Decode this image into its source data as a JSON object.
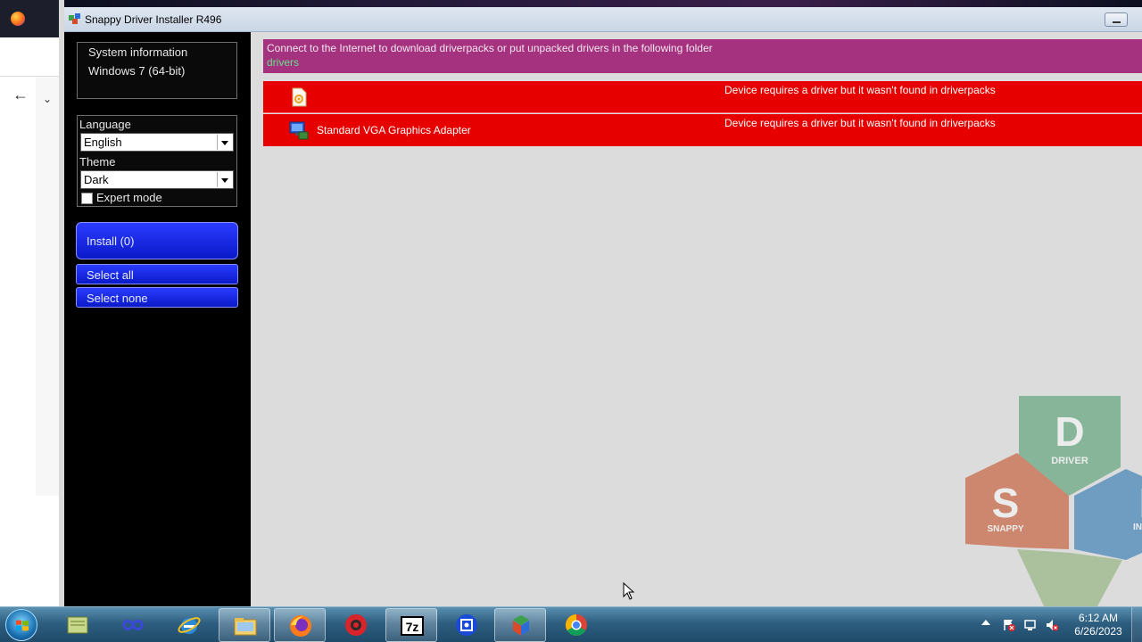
{
  "window": {
    "title": "Snappy Driver Installer R496"
  },
  "sidebar": {
    "system_info_label": "System information",
    "os": "Windows 7 (64-bit)",
    "language_label": "Language",
    "language_value": "English",
    "theme_label": "Theme",
    "theme_value": "Dark",
    "expert_mode_label": "Expert mode",
    "install_label": "Install (0)",
    "select_all_label": "Select all",
    "select_none_label": "Select none"
  },
  "banner": {
    "message": "Connect to the Internet to download driverpacks or put unpacked drivers in the following folder",
    "folder": "drivers"
  },
  "devices": [
    {
      "name": "",
      "status": "Device requires a driver but it wasn't found in driverpacks",
      "icon": "unknown-device-icon"
    },
    {
      "name": "Standard VGA Graphics Adapter",
      "status": "Device requires a driver but it wasn't found in driverpacks",
      "icon": "display-adapter-icon"
    }
  ],
  "logo": {
    "words": [
      "DRIVER",
      "SNAPPY",
      "INSTA"
    ],
    "letters": [
      "D",
      "S",
      "I"
    ]
  },
  "taskbar": {
    "clock_time": "6:12 AM",
    "clock_date": "6/26/2023"
  },
  "colors": {
    "banner": "#a5327f",
    "device_row": "#e60000",
    "button": "#1a28e0",
    "content_bg": "#dcdcdc"
  }
}
